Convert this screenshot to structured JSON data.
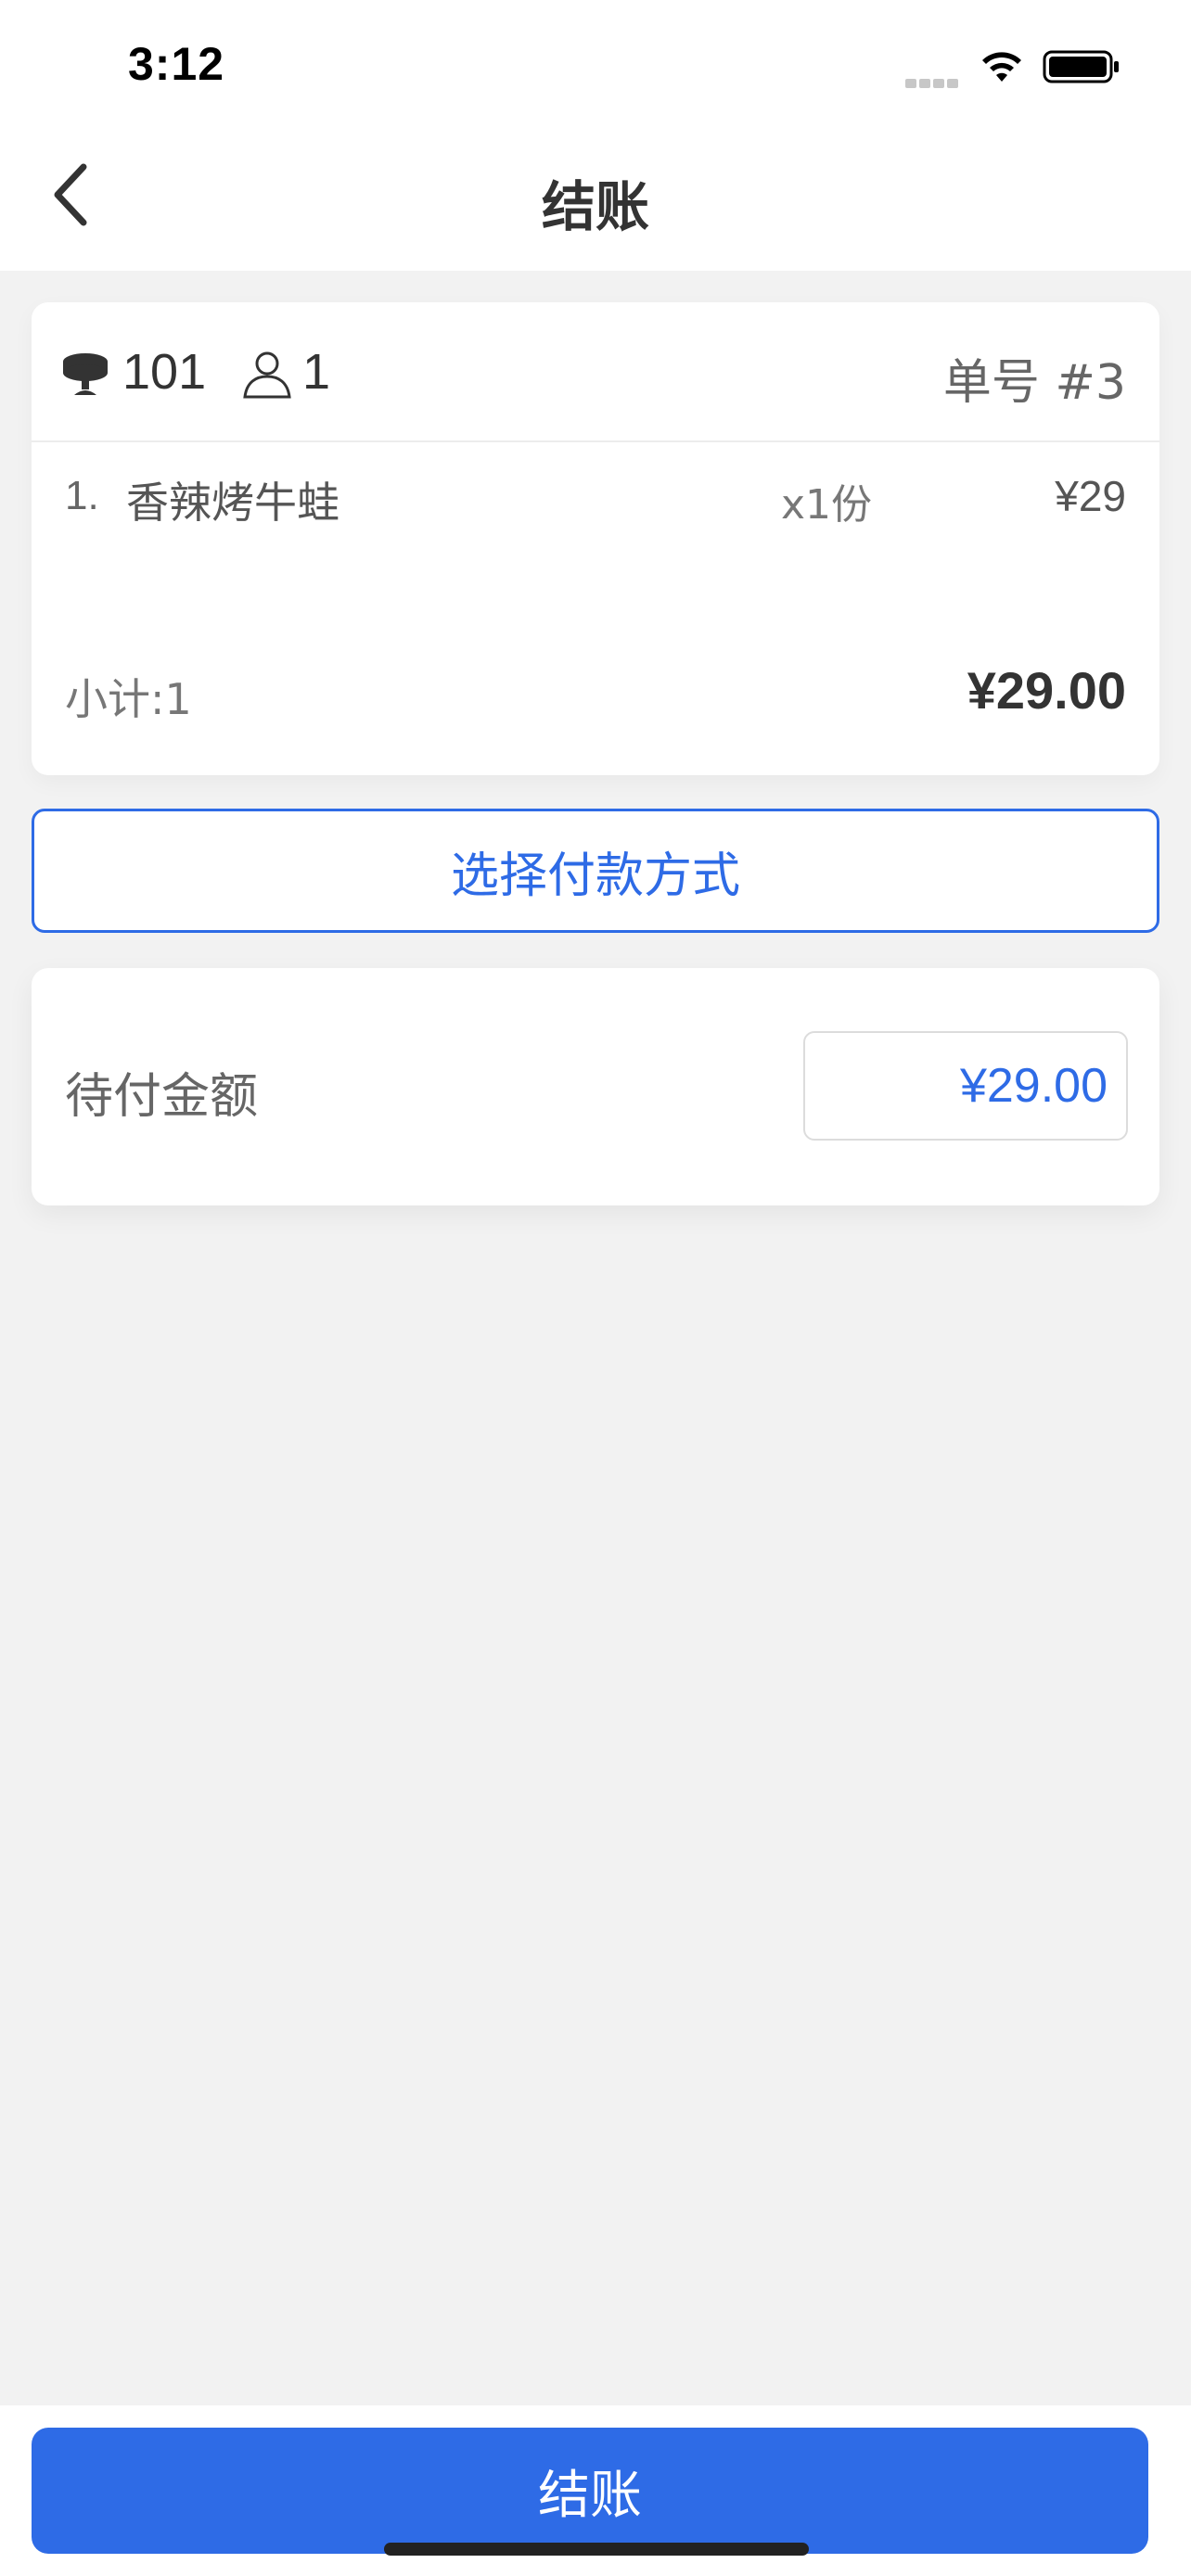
{
  "status_bar": {
    "time": "3:12"
  },
  "nav": {
    "title": "结账",
    "back_icon": "chevron-left-icon"
  },
  "order": {
    "table_icon": "table-icon",
    "table_number": "101",
    "person_icon": "person-icon",
    "guest_count": "1",
    "order_number": "单号 #3",
    "items": [
      {
        "index": "1.",
        "name": "香辣烤牛蛙",
        "qty": "x1份",
        "price": "¥29"
      }
    ],
    "subtotal_label": "小计:1",
    "subtotal_value": "¥29.00"
  },
  "payment": {
    "select_method_label": "选择付款方式"
  },
  "amount_due": {
    "label": "待付金额",
    "value": "¥29.00"
  },
  "bottom": {
    "checkout_label": "结账"
  },
  "colors": {
    "accent": "#2e6be6",
    "background": "#f2f2f2",
    "card": "#ffffff"
  }
}
